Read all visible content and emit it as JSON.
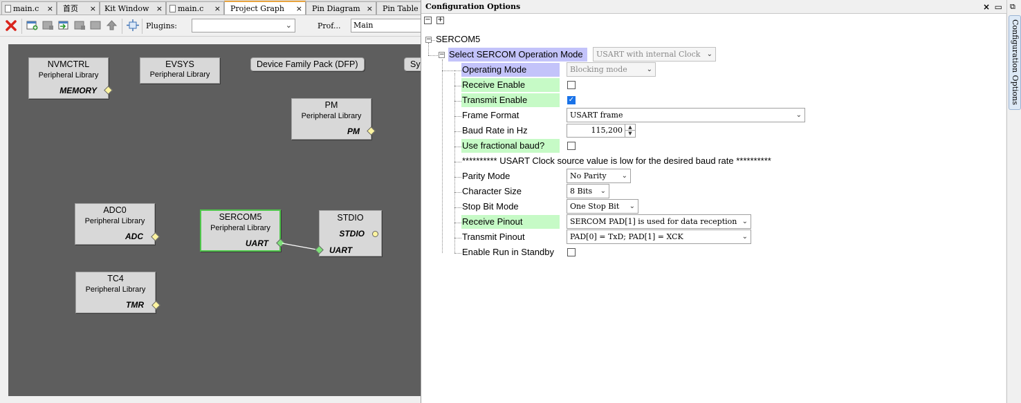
{
  "tabs": [
    {
      "label": "main.c",
      "file": true,
      "active": false
    },
    {
      "label": "首页",
      "file": false,
      "active": false
    },
    {
      "label": "Kit Window",
      "file": false,
      "active": false
    },
    {
      "label": "main.c",
      "file": true,
      "active": false
    },
    {
      "label": "Project Graph",
      "file": false,
      "active": true
    },
    {
      "label": "Pin Diagram",
      "file": false,
      "active": false
    },
    {
      "label": "Pin Table",
      "file": false,
      "active": false
    }
  ],
  "tab_close": "×",
  "toolbar": {
    "plugins_label": "Plugins:",
    "plugins_value": "",
    "profile_label": "Prof...",
    "profile_value": "Main"
  },
  "graph": {
    "nodes": {
      "nvmctrl": {
        "name": "NVMCTRL",
        "lib": "Peripheral Library",
        "iface": "MEMORY"
      },
      "evsys": {
        "name": "EVSYS",
        "lib": "Peripheral Library"
      },
      "pm": {
        "name": "PM",
        "lib": "Peripheral Library",
        "iface": "PM"
      },
      "adc0": {
        "name": "ADC0",
        "lib": "Peripheral Library",
        "iface": "ADC"
      },
      "sercom5": {
        "name": "SERCOM5",
        "lib": "Peripheral Library",
        "iface": "UART"
      },
      "stdio": {
        "name": "STDIO",
        "iface1": "STDIO",
        "iface2": "UART"
      },
      "tc4": {
        "name": "TC4",
        "lib": "Peripheral Library",
        "iface": "TMR"
      }
    },
    "dfp_label": "Device Family Pack (DFP)",
    "partial_label": "Sy"
  },
  "config": {
    "title": "Configuration Options",
    "collapse": "−",
    "expand": "+",
    "root": "SERCOM5",
    "rows": {
      "op_mode_sel": {
        "label": "Select SERCOM Operation Mode",
        "value": "USART with internal Clock"
      },
      "operating_mode": {
        "label": "Operating Mode",
        "value": "Blocking mode"
      },
      "receive_enable": {
        "label": "Receive Enable",
        "checked": false
      },
      "transmit_enable": {
        "label": "Transmit Enable",
        "checked": true
      },
      "frame_format": {
        "label": "Frame Format",
        "value": "USART frame"
      },
      "baud_rate": {
        "label": "Baud Rate in Hz",
        "value": "115,200"
      },
      "frac_baud": {
        "label": "Use fractional baud?",
        "checked": false
      },
      "warning": "********** USART Clock source value is low for the desired baud rate **********",
      "parity": {
        "label": "Parity Mode",
        "value": "No Parity"
      },
      "char_size": {
        "label": "Character Size",
        "value": "8 Bits"
      },
      "stop_bit": {
        "label": "Stop Bit Mode",
        "value": "One Stop Bit"
      },
      "rx_pinout": {
        "label": "Receive Pinout",
        "value": "SERCOM PAD[1] is used for data reception"
      },
      "tx_pinout": {
        "label": "Transmit Pinout",
        "value": "PAD[0] = TxD; PAD[1] = XCK"
      },
      "run_standby": {
        "label": "Enable Run in Standby",
        "checked": false
      }
    }
  },
  "side_tab": "Configuration Options",
  "colors": {
    "highlight_purple": "#c3c3fa",
    "highlight_green": "#c6fac6",
    "selected_border": "#4ec64a",
    "canvas_bg": "#5e5e5e",
    "checkbox_on": "#1a73e8",
    "diamond_yellow": "#fbf3a0",
    "diamond_green": "#7ee07a",
    "close_red": "#d9241c"
  }
}
